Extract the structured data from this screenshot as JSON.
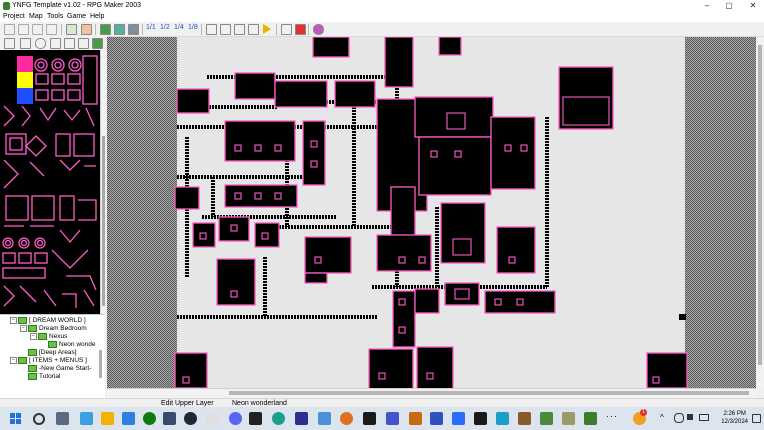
{
  "window": {
    "title": "YNFG Template v1.02 - RPG Maker 2003",
    "controls": [
      "–",
      "▢",
      "✕"
    ]
  },
  "menu": [
    "Project",
    "Map",
    "Tools",
    "Game",
    "Help"
  ],
  "toolbar": {
    "layer_buttons": [
      "1/1",
      "1/2",
      "1/4",
      "1/8"
    ]
  },
  "tree": {
    "items": [
      {
        "label": "[ DREAM WORLD ]",
        "level": 0,
        "expander": "−"
      },
      {
        "label": "Dream Bedroom",
        "level": 1,
        "expander": "−"
      },
      {
        "label": "Nexus",
        "level": 2,
        "expander": "−"
      },
      {
        "label": "Neon wonde",
        "level": 3,
        "expander": ""
      },
      {
        "label": "[Deep Areas]",
        "level": 1,
        "expander": ""
      },
      {
        "label": "[ ITEMS + MENUS ]",
        "level": 0,
        "expander": "−"
      },
      {
        "label": "-New Game Start-",
        "level": 1,
        "expander": ""
      },
      {
        "label": "Tutorial",
        "level": 1,
        "expander": ""
      }
    ]
  },
  "status": {
    "mode": "Edit Upper Layer",
    "map_name": "Neon wonderland"
  },
  "taskbar": {
    "time": "2:26 PM",
    "date": "12/3/2024",
    "notification_count": "1"
  },
  "colors": {
    "map_background": "#e6e6e6",
    "building_fill": "#000000",
    "neon_outline": "#ff5cc8",
    "palette_yellow": "#ffff00",
    "palette_blue": "#1e50ff",
    "palette_magenta": "#ff2aa0"
  }
}
